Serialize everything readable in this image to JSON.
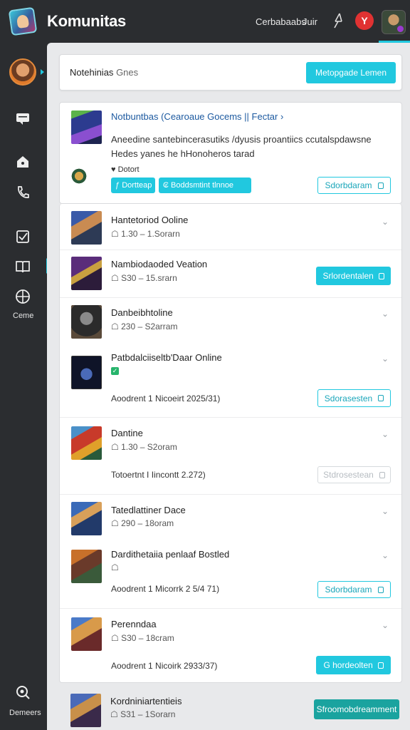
{
  "header": {
    "title": "Komunitas",
    "links": [
      "Cerbabaabs",
      "Juir"
    ],
    "notif_label": "Y"
  },
  "sidebar": {
    "bottom_top_label": "Ceme",
    "bottom_label": "Demeers"
  },
  "search_bar": {
    "title": "Notehinias",
    "subtitle": "Gnes",
    "button_label": "Metopgade Lemen"
  },
  "featured": {
    "title": "Notbuntbas (Cearoaue Gocems || Fectar ›",
    "description": "Aneedine santebincerasutiks /dyusis proantiics ccutalspdawsne Hedes yanes he hHonoheros tarad",
    "tag": "Dotort",
    "chips": [
      "Dortteap",
      "Boddsmtint tlnnoe"
    ],
    "button_label": "Sdorbdaram"
  },
  "games": [
    {
      "title": "Hantetoriod Ooline",
      "meta": "1.30 – 1.Sorarn",
      "note": "",
      "button": "",
      "button_style": "",
      "icon": "chevron-down"
    },
    {
      "title": "Nambiodaoded Veation",
      "meta": "S30 – 15.srarn",
      "note": "",
      "button": "Srlordentalen",
      "button_style": "filled",
      "icon": ""
    },
    {
      "title": "Danbeibhtoline",
      "meta": "230 – S2arram",
      "note": "",
      "button": "",
      "button_style": "",
      "icon": "chevron-down"
    },
    {
      "title": "Patbdalciiseltb'Daar Online",
      "meta": "",
      "note": "Aoodrent 1 Nicoeirt 2025/31)",
      "button": "Sdorasesten",
      "button_style": "outline",
      "icon": "chevron-down",
      "check": true
    },
    {
      "title": "Dantine",
      "meta": "1.30 – S2oram",
      "note": "Totoertnt I Iincontt 2.272)",
      "button": "Stdrosestean",
      "button_style": "faint",
      "icon": "chevron-down"
    },
    {
      "title": "Tatedlattiner Dace",
      "meta": "290 – 18oram",
      "note": "",
      "button": "",
      "button_style": "",
      "icon": "chevron-down"
    },
    {
      "title": "Dardithetaiia penlaaf Bostled",
      "meta": "",
      "note": "Aoodrent 1 Micorrk 2 5/4 71)",
      "button": "Sdorbdaram",
      "button_style": "outline",
      "icon": "chevron-down"
    },
    {
      "title": "Perenndaa",
      "meta": "S30 – 18cram",
      "note": "Aoodrent 1 Nicoirk 2933/37)",
      "button": "G hordeolten",
      "button_style": "filled",
      "icon": "chevron-down"
    }
  ],
  "bottom_item": {
    "title": "Kordniniartentieis",
    "meta": "S31 – 1Sorarn",
    "button": "Sfroomobdreamment"
  },
  "colors": {
    "accent": "#21c8df",
    "sidebar": "#2b2d30",
    "teal_button": "#1aa39f"
  }
}
